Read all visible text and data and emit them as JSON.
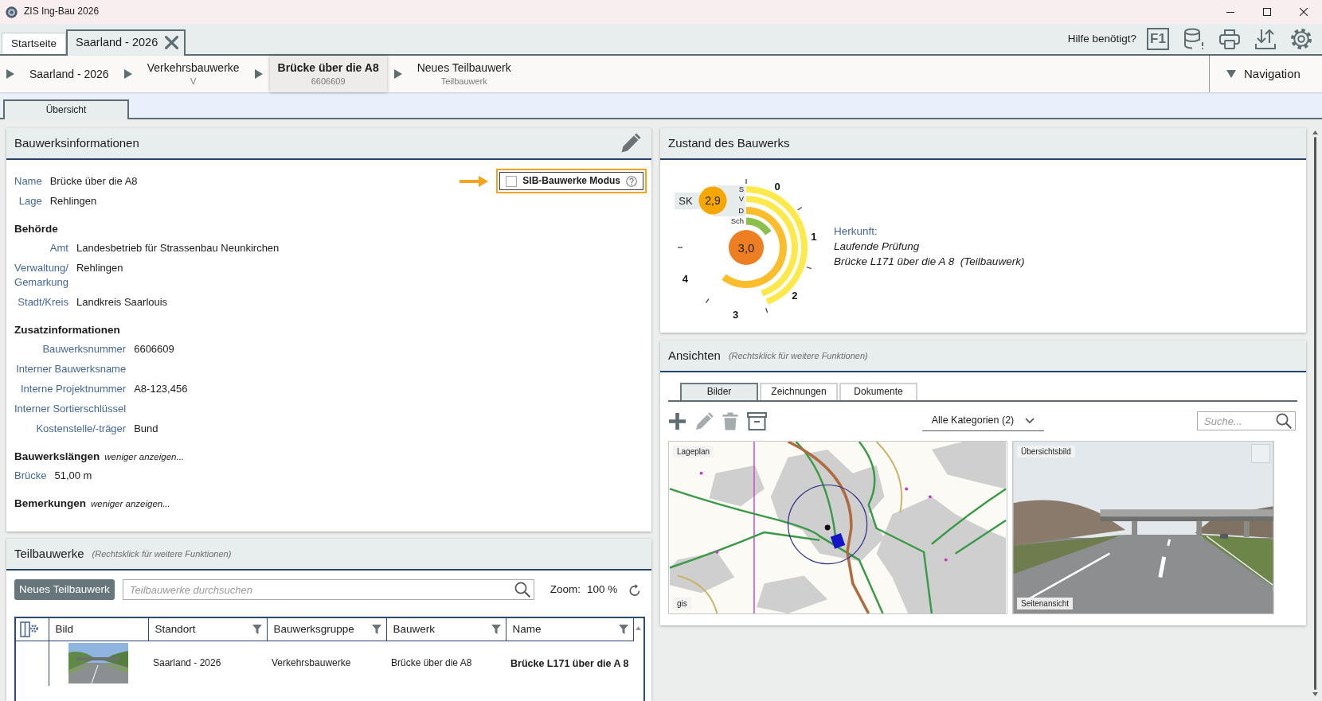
{
  "window": {
    "title": "ZIS Ing-Bau 2026"
  },
  "tabs": [
    {
      "label": "Startseite",
      "selected": false,
      "closable": false
    },
    {
      "label": "Saarland - 2026",
      "selected": true,
      "closable": true
    }
  ],
  "help": {
    "label": "Hilfe benötigt?",
    "key": "F1"
  },
  "breadcrumb": [
    {
      "title": "Saarland - 2026",
      "selected": false
    },
    {
      "title": "Verkehrsbauwerke",
      "subtitle": "V",
      "selected": false
    },
    {
      "title": "Brücke über die A8",
      "subtitle": "6606609",
      "selected": true
    },
    {
      "title": "Neues Teilbauwerk",
      "subtitle": "Teilbauwerk",
      "selected": false
    }
  ],
  "navigation": {
    "label": "Navigation"
  },
  "page_tabs": [
    {
      "label": "Übersicht",
      "selected": true
    }
  ],
  "building_info": {
    "title": "Bauwerksinformationen",
    "sib_mode": {
      "label": "SIB-Bauwerke Modus",
      "checked": false,
      "highlighted": true
    },
    "fields": [
      {
        "label": "Name",
        "value": "Brücke über die A8"
      },
      {
        "label": "Lage",
        "value": "Rehlingen"
      }
    ],
    "sections": [
      {
        "heading": "Behörde",
        "fields": [
          {
            "label": "Amt",
            "value": "Landesbetrieb für Strassenbau Neunkirchen"
          },
          {
            "label": "Verwaltung/ Gemarkung",
            "value": "Rehlingen"
          },
          {
            "label": "Stadt/Kreis",
            "value": "Landkreis Saarlouis"
          }
        ]
      },
      {
        "heading": "Zusatzinformationen",
        "fields": [
          {
            "label": "Bauwerksnummer",
            "value": "6606609"
          },
          {
            "label": "Interner Bauwerksname"
          },
          {
            "label": "Interne Projektnummer",
            "value": "A8-123,456"
          },
          {
            "label": "Interner Sortierschlüssel"
          },
          {
            "label": "Kostenstelle/-träger",
            "value": "Bund"
          }
        ]
      },
      {
        "heading": "Bauwerkslängen",
        "toggle": "weniger anzeigen...",
        "fields": [
          {
            "label": "Brücke",
            "value": "51,00 m"
          }
        ]
      },
      {
        "heading": "Bemerkungen",
        "toggle": "weniger anzeigen..."
      }
    ]
  },
  "condition": {
    "title": "Zustand des Bauwerks",
    "sk": {
      "label": "SK",
      "value": "2,9"
    },
    "overall": "3,0",
    "rings": [
      {
        "label": "S",
        "color": "#fde94b"
      },
      {
        "label": "V",
        "color": "#fde94b"
      },
      {
        "label": "D",
        "color": "#fcbd2c"
      },
      {
        "label": "Sch",
        "color": "#8cc04b"
      }
    ],
    "scale": [
      "0",
      "1",
      "2",
      "3",
      "4"
    ],
    "origin": {
      "label": "Herkunft:",
      "lines": [
        "Laufende Prüfung",
        "Brücke L171 über die A 8  (Teilbauwerk)"
      ]
    }
  },
  "views": {
    "title": "Ansichten",
    "hint": "(Rechtsklick für weitere Funktionen)",
    "tabs": [
      {
        "label": "Bilder",
        "selected": true
      },
      {
        "label": "Zeichnungen",
        "selected": false
      },
      {
        "label": "Dokumente",
        "selected": false
      }
    ],
    "toolbar": [
      {
        "kind": "add",
        "disabled": false
      },
      {
        "kind": "edit",
        "disabled": true
      },
      {
        "kind": "delete",
        "disabled": true
      },
      {
        "kind": "archive",
        "disabled": false
      }
    ],
    "category_filter": "Alle Kategorien (2)",
    "search": {
      "placeholder": "Suche..."
    },
    "images": [
      {
        "kind": "map",
        "caption": "Lageplan",
        "footer": "gis"
      },
      {
        "kind": "photo",
        "caption": "Übersichtsbild",
        "footer": "Seitenansicht",
        "checked": false
      }
    ]
  },
  "sub_structures": {
    "title": "Teilbauwerke",
    "hint": "(Rechtsklick für weitere Funktionen)",
    "new_button": "Neues Teilbauwerk",
    "search": {
      "placeholder": "Teilbauwerke durchsuchen"
    },
    "zoom": {
      "label": "Zoom:",
      "value": "100 %"
    },
    "table": {
      "columns": [
        {
          "label": "Bild",
          "kind": "image",
          "filter": false
        },
        {
          "label": "Standort",
          "kind": "text",
          "filter": true
        },
        {
          "label": "Bauwerksgruppe",
          "kind": "text",
          "filter": true
        },
        {
          "label": "Bauwerk",
          "kind": "text",
          "filter": true
        },
        {
          "label": "Name",
          "kind": "title",
          "filter": true
        }
      ],
      "rows": [
        {
          "thumbnail": true,
          "cells": [
            "",
            "Saarland - 2026",
            "Verkehrsbauwerke",
            "Brücke über die A8",
            "Brücke L171 über die A 8"
          ]
        }
      ]
    }
  }
}
